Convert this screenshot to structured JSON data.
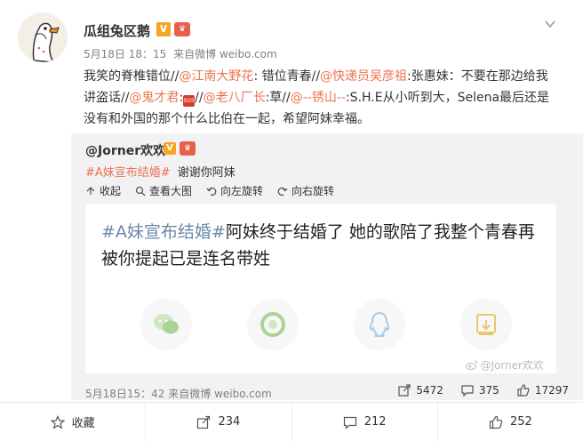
{
  "post": {
    "username": "瓜组兔区鹅",
    "time": "5月18日 18：15",
    "source": "来自微博 weibo.com",
    "text_parts": [
      {
        "t": "我笑的脊椎错位//"
      },
      {
        "t": "@江南大野花",
        "m": true
      },
      {
        "t": ": 错位青春//"
      },
      {
        "t": "@快递员吴彦祖",
        "m": true
      },
      {
        "t": ":张惠妹：不要在那边给我讲盗话//"
      },
      {
        "t": "@鬼才君",
        "m": true
      },
      {
        "t": ":"
      },
      {
        "sos": "SOS"
      },
      {
        "t": "//"
      },
      {
        "t": "@老八厂长",
        "m": true
      },
      {
        "t": ":草//"
      },
      {
        "t": "@--锈山--",
        "m": true
      },
      {
        "t": ":S.H.E从小听到大，Selena最后还是没有和外国的那个什么比伯在一起，希望阿妹幸福。"
      }
    ]
  },
  "repost": {
    "orig_username": "@Jorner欢欢",
    "topic": "#A妹宣布结婚#",
    "orig_text": "谢谢你阿妹",
    "toolbar": [
      "收起",
      "查看大图",
      "向左旋转",
      "向右旋转"
    ],
    "image_tag": "#A妹宣布结婚#",
    "image_text": "阿妹终于结婚了  她的歌陪了我整个青春再被你提起已是连名带姓",
    "watermark": "@Jorner欢欢",
    "meta": "5月18日15：42 来自微博 weibo.com",
    "stats": {
      "share": "5472",
      "comment": "375",
      "like": "17297"
    }
  },
  "actions": {
    "favorite": "收藏",
    "forward": "234",
    "comment": "212",
    "like": "252"
  },
  "colors": {
    "mention": "#eb7350",
    "repost_bg": "#f2f2f5",
    "vip": "#f5a623"
  }
}
